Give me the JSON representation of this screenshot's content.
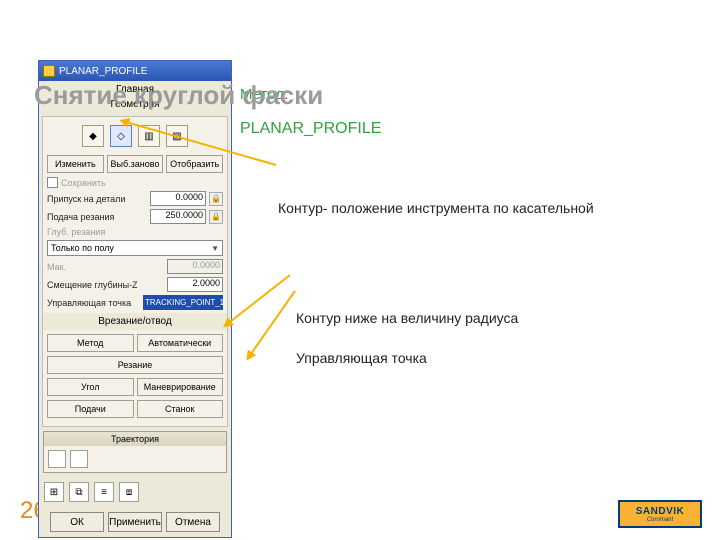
{
  "slide": {
    "title": "Снятие круглой фаски",
    "method_label_green": "Метод",
    "method_label_red": ":",
    "method_value": "PLANAR_PROFILE",
    "page_number": "26"
  },
  "annotations": {
    "contour_tangent": "Контур- положение инструмента по касательной",
    "contour_below": "Контур ниже на величину радиуса",
    "control_point": "Управляющая точка"
  },
  "dialog": {
    "title": "PLANAR_PROFILE",
    "main_section": "Геометрия",
    "geometry_buttons": {
      "edit": "Изменить",
      "reselect": "Выб.заново",
      "display": "Отобразить"
    },
    "save_checkbox_label": "Сохранить",
    "fields": {
      "part_stock_label": "Припуск на детали",
      "part_stock_value": "0.0000",
      "feed_label": "Подача резания",
      "feed_value": "250.0000",
      "cut_depth_label": "Глуб. резания",
      "floor_only": "Только по полу",
      "max_label": "Мак.",
      "max_value": "0.0000",
      "z_offset_label": "Смещение глубины-Z",
      "z_offset_value": "2.0000",
      "control_point_label": "Управляющая точка",
      "control_point_value": "TRACKING_POINT_1"
    },
    "engage_section": "Врезание/отвод",
    "engage_buttons": {
      "method": "Метод",
      "auto": "Автоматически",
      "cutting": "Резание",
      "corner": "Угол",
      "maneuver": "Маневрирование",
      "feeds": "Подачи",
      "machine": "Станок"
    },
    "trajectory_label": "Траектория",
    "dialog_buttons": {
      "ok": "ОК",
      "apply": "Применить",
      "cancel": "Отмена"
    }
  },
  "logo": {
    "brand": "SANDVIK",
    "sub": "Coromant"
  }
}
